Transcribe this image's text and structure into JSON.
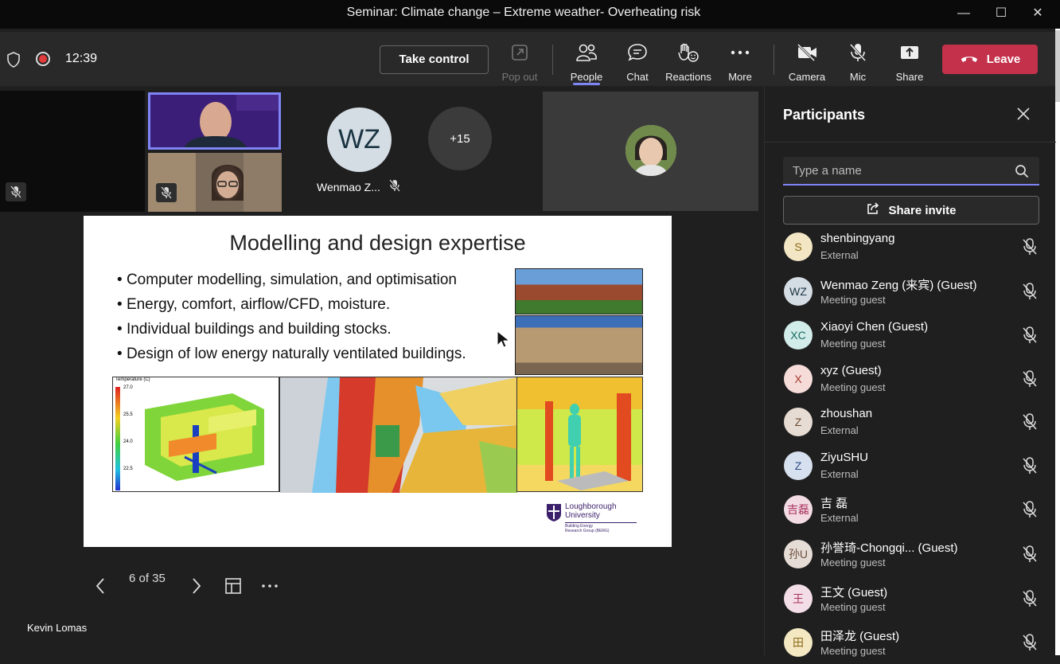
{
  "window": {
    "title": "Seminar: Climate change – Extreme weather- Overheating risk",
    "minimize": "—",
    "maximize": "☐",
    "close": "✕"
  },
  "toolbar": {
    "time": "12:39",
    "take_control": "Take control",
    "items": [
      {
        "label": "Pop out",
        "icon": "pop-out-icon",
        "disabled": true
      },
      {
        "label": "People",
        "icon": "people-icon",
        "active": true
      },
      {
        "label": "Chat",
        "icon": "chat-icon"
      },
      {
        "label": "Reactions",
        "icon": "reactions-icon"
      },
      {
        "label": "More",
        "icon": "more-icon"
      },
      {
        "label": "Camera",
        "icon": "camera-off-icon"
      },
      {
        "label": "Mic",
        "icon": "mic-off-icon"
      },
      {
        "label": "Share",
        "icon": "share-icon"
      }
    ],
    "leave": "Leave",
    "leave_color": "#c4314b",
    "accent_color": "#7f85f5"
  },
  "gallery": {
    "wz_initials": "WZ",
    "wz_name": "Wenmao Z...",
    "overflow_count": "+15"
  },
  "slide": {
    "title": "Modelling and design expertise",
    "bullets": [
      "Computer modelling, simulation, and optimisation",
      "Energy, comfort, airflow/CFD, moisture.",
      "Individual buildings and building stocks.",
      "Design of low energy naturally ventilated buildings."
    ],
    "thermal_label": "Temperature (C)",
    "thermal_ticks": [
      "27.0",
      "25.5",
      "24.0",
      "22.5"
    ],
    "logo_line1": "Loughborough",
    "logo_line2": "University",
    "logo_sub1": "Building Energy",
    "logo_sub2": "Research Group (BERG)"
  },
  "slide_controls": {
    "page": "6 of 35"
  },
  "speaker": {
    "name": "Kevin Lomas"
  },
  "participants": {
    "title": "Participants",
    "search_placeholder": "Type a name",
    "share_invite": "Share invite",
    "list": [
      {
        "initials": "S",
        "name": "shenbingyang",
        "role": "External",
        "bg": "#f3e6c4",
        "fg": "#8a6a1a"
      },
      {
        "initials": "WZ",
        "name": "Wenmao Zeng (来宾) (Guest)",
        "role": "Meeting guest",
        "bg": "#d5dde4",
        "fg": "#1a3442"
      },
      {
        "initials": "XC",
        "name": "Xiaoyi Chen (Guest)",
        "role": "Meeting guest",
        "bg": "#d2ece9",
        "fg": "#1b6a62"
      },
      {
        "initials": "X",
        "name": "xyz (Guest)",
        "role": "Meeting guest",
        "bg": "#f6dcd9",
        "fg": "#a3392c"
      },
      {
        "initials": "Z",
        "name": "zhoushan",
        "role": "External",
        "bg": "#e7dcd3",
        "fg": "#6b4a32"
      },
      {
        "initials": "Z",
        "name": "ZiyuSHU",
        "role": "External",
        "bg": "#d7e0ef",
        "fg": "#2d4e86"
      },
      {
        "initials": "吉磊",
        "name": "吉 磊",
        "role": "External",
        "bg": "#f3dbe4",
        "fg": "#a8325c"
      },
      {
        "initials": "孙U",
        "name": "孙誉琦-Chongqi...  (Guest)",
        "role": "Meeting guest",
        "bg": "#e6dcd6",
        "fg": "#6b4e3c"
      },
      {
        "initials": "王",
        "name": "王文 (Guest)",
        "role": "Meeting guest",
        "bg": "#f3dde6",
        "fg": "#a8325c"
      },
      {
        "initials": "田",
        "name": "田泽龙 (Guest)",
        "role": "Meeting guest",
        "bg": "#f4e8c3",
        "fg": "#8a6a1a"
      }
    ]
  }
}
